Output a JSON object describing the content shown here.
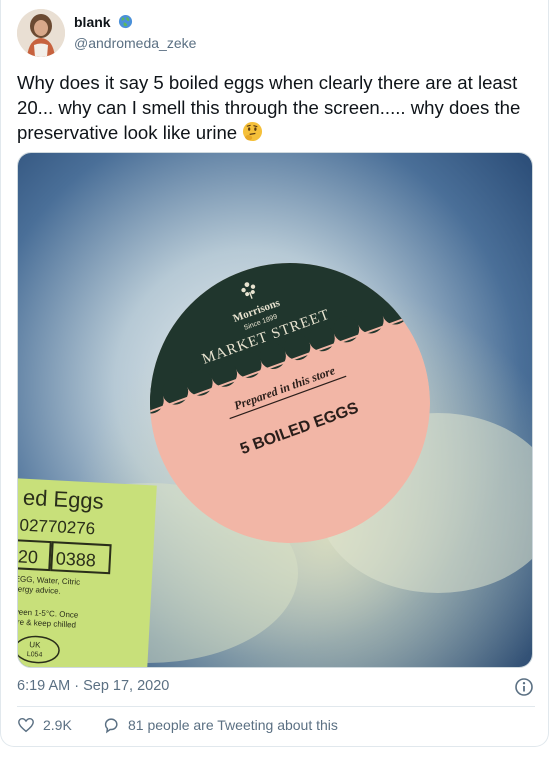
{
  "tweet": {
    "display_name": "blank",
    "handle": "@andromeda_zeke",
    "text": "Why does it say 5 boiled eggs when clearly there are at least 20... why can I smell this through the screen..... why does the preservative look like urine",
    "timestamp": "6:19 AM · Sep 17, 2020",
    "likes": "2.9K",
    "tweeting_about": "81 people are Tweeting about this"
  },
  "image": {
    "brand": "Morrisons",
    "since": "Since 1899",
    "market": "MARKET STREET",
    "prepared": "Prepared in this store",
    "product": "5 BOILED EGGS",
    "label_title": "ed Eggs",
    "label_code": "02770276",
    "label_num_a": "20",
    "label_num_b": "0388",
    "label_ingredients_1": "EGG, Water, Citric",
    "label_ingredients_2": "llergy advice.",
    "label_storage_1": "ween 1-5°C. Once",
    "label_storage_2": "ure & keep chilled",
    "label_oval_1": "UK",
    "label_oval_2": "L054"
  },
  "icons": {
    "globe": "globe-icon",
    "emoji": "thinking-face-emoji",
    "info": "info-icon",
    "like": "heart-icon",
    "reply": "reply-icon"
  },
  "colors": {
    "text": "#0f1419",
    "muted": "#5b7083",
    "sticker_pink": "#f2b6a6",
    "sticker_green": "#20362d",
    "label_green": "#c8e07a"
  }
}
